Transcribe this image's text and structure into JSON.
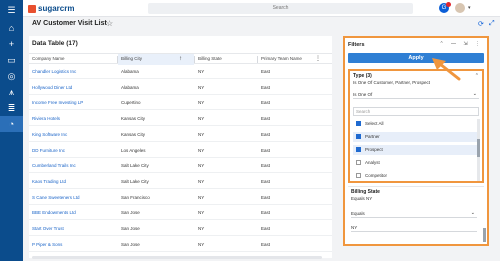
{
  "topbar": {
    "logo_text": "sugarcrm",
    "search_placeholder": "Search",
    "notification_letter": "G",
    "caret": "▾"
  },
  "nav": {
    "items": [
      {
        "icon": "menu-icon",
        "glyph": "☰"
      },
      {
        "icon": "home-icon",
        "glyph": "⌂"
      },
      {
        "icon": "add-icon",
        "glyph": "+"
      },
      {
        "icon": "folder-icon",
        "glyph": "▭"
      },
      {
        "icon": "user-icon",
        "glyph": "◎"
      },
      {
        "icon": "filter-icon",
        "glyph": "⩚"
      },
      {
        "icon": "layers-icon",
        "glyph": "≣"
      },
      {
        "icon": "chart-icon",
        "glyph": "◔"
      }
    ]
  },
  "header": {
    "title": "AV Customer Visit List",
    "star_glyph": "☆",
    "refresh_glyph": "⟳",
    "expand_glyph": "⤢"
  },
  "table": {
    "title": "Data Table (17)",
    "columns": [
      "Company Name",
      "Billing City",
      "Billing State",
      "Primary Team Name"
    ],
    "sort_glyph": "↑",
    "kebab_glyph": "⋮",
    "rows": [
      [
        "Chandler Logistics Inc",
        "Alabama",
        "NY",
        "East"
      ],
      [
        "Hollywood Diner Ltd",
        "Alabama",
        "NY",
        "East"
      ],
      [
        "Income Free Investing LP",
        "Cupertino",
        "NY",
        "East"
      ],
      [
        "Riviera Hotels",
        "Kansas City",
        "NY",
        "East"
      ],
      [
        "King Software Inc",
        "Kansas City",
        "NY",
        "East"
      ],
      [
        "DD Furniture Inc",
        "Los Angeles",
        "NY",
        "East"
      ],
      [
        "Cumberland Trails Inc",
        "Salt Lake City",
        "NY",
        "East"
      ],
      [
        "Kaos Trading Ltd",
        "Salt Lake City",
        "NY",
        "East"
      ],
      [
        "S Cane Sweeteners Ltd",
        "San Francisco",
        "NY",
        "East"
      ],
      [
        "BBE Endowments Ltd",
        "San Jose",
        "NY",
        "East"
      ],
      [
        "Start Over Trust",
        "San Jose",
        "NY",
        "East"
      ],
      [
        "P Piper & Sons",
        "San Jose",
        "NY",
        "East"
      ]
    ]
  },
  "filters": {
    "title": "Filters",
    "icons": "⌃ — ⇲ ⋮",
    "apply_label": "Apply",
    "type": {
      "label": "Type (3)",
      "summary": "Is One Of Customer, Partner, Prospect",
      "operator": "Is One Of",
      "search_placeholder": "Search",
      "options": [
        {
          "label": "Select All",
          "checked": true
        },
        {
          "label": "Partner",
          "checked": true
        },
        {
          "label": "Prospect",
          "checked": true
        },
        {
          "label": "Analyst",
          "checked": false
        },
        {
          "label": "Competitor",
          "checked": false
        }
      ]
    },
    "billing_state": {
      "label": "Billing State",
      "summary": "Equals NY",
      "operator": "Equals",
      "value": "NY"
    }
  },
  "colors": {
    "nav_bg": "#0b4c8c",
    "highlight": "#f0963e",
    "apply_bg": "#2f7fd4",
    "link": "#1a64c8"
  }
}
